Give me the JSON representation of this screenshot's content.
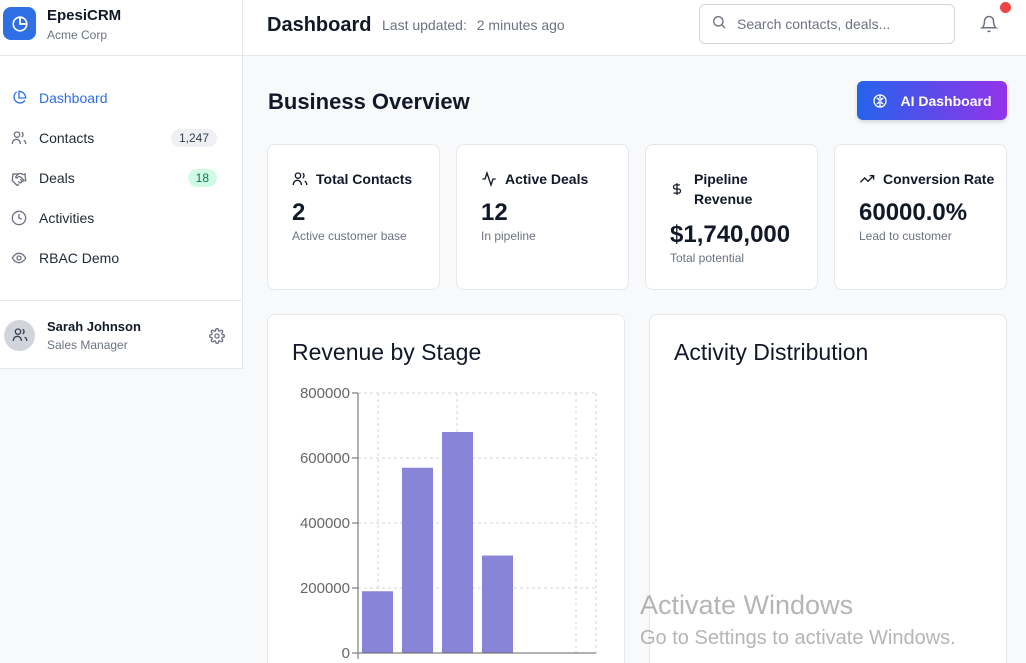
{
  "app": {
    "name": "EpesiCRM",
    "org": "Acme Corp"
  },
  "sidebar": {
    "items": [
      {
        "label": "Dashboard",
        "icon": "pie-chart-icon",
        "active": true
      },
      {
        "label": "Contacts",
        "icon": "users-icon",
        "badge": "1,247"
      },
      {
        "label": "Deals",
        "icon": "handshake-icon",
        "badge": "18"
      },
      {
        "label": "Activities",
        "icon": "clock-icon"
      },
      {
        "label": "RBAC Demo",
        "icon": "eye-icon"
      }
    ],
    "user": {
      "name": "Sarah Johnson",
      "role": "Sales Manager"
    }
  },
  "header": {
    "title": "Dashboard",
    "last_updated_label": "Last updated:",
    "last_updated_value": "2 minutes ago",
    "search_placeholder": "Search contacts, deals..."
  },
  "main": {
    "section_title": "Business Overview",
    "ai_button": "AI Dashboard",
    "stats": [
      {
        "label": "Total Contacts",
        "value": "2",
        "sub": "Active customer base",
        "icon": "users-icon"
      },
      {
        "label": "Active Deals",
        "value": "12",
        "sub": "In pipeline",
        "icon": "activity-icon"
      },
      {
        "label": "Pipeline Revenue",
        "value": "$1,740,000",
        "sub": "Total potential",
        "icon": "dollar-icon"
      },
      {
        "label": "Conversion Rate",
        "value": "60000.0%",
        "sub": "Lead to customer",
        "icon": "trending-up-icon"
      }
    ],
    "revenue_panel_title": "Revenue by Stage",
    "activity_panel_title": "Activity Distribution"
  },
  "watermark": {
    "line1": "Activate Windows",
    "line2": "Go to Settings to activate Windows."
  },
  "colors": {
    "accent": "#2f6fe6",
    "bar": "#8884d8",
    "badge_green_bg": "#d1fae5",
    "notification": "#ef4444"
  },
  "chart_data": {
    "type": "bar",
    "values": [
      190000,
      570000,
      680000,
      300000,
      0,
      0
    ],
    "yticks": [
      0,
      200000,
      400000,
      600000,
      800000
    ],
    "ylim": [
      0,
      800000
    ],
    "grid": true
  }
}
